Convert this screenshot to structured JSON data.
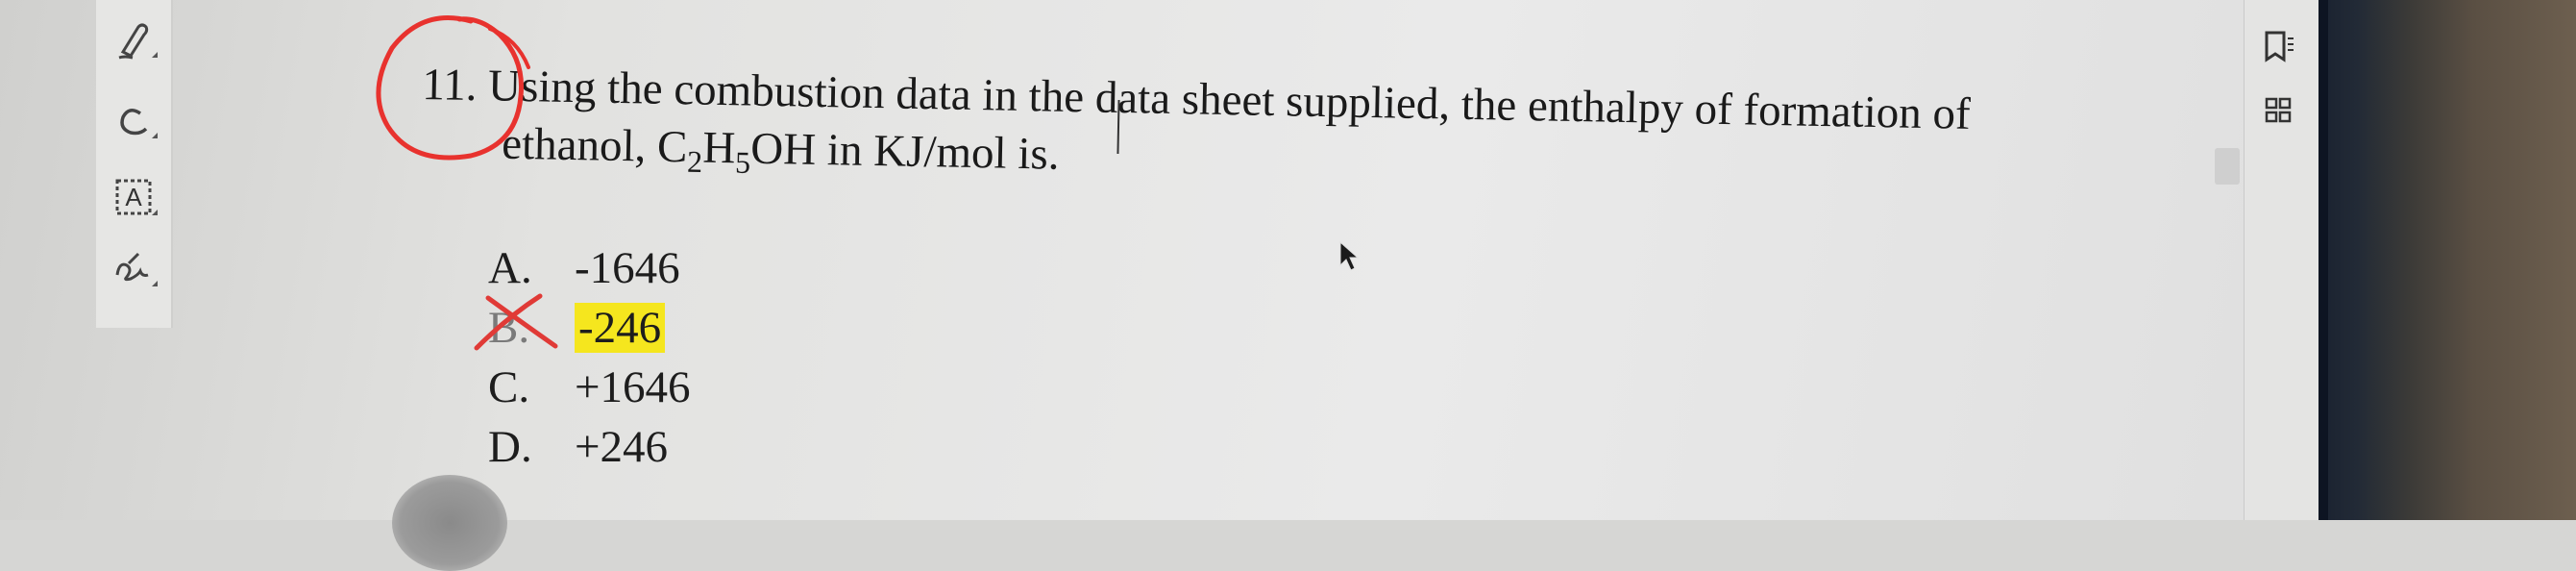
{
  "toolbar": {
    "tools": [
      {
        "name": "pen-tool",
        "icon": "pen-icon"
      },
      {
        "name": "lasso-tool",
        "icon": "lasso-icon"
      },
      {
        "name": "text-box-tool",
        "icon": "text-box-icon",
        "label": "A"
      },
      {
        "name": "signature-tool",
        "icon": "signature-icon"
      }
    ]
  },
  "question": {
    "number": "11.",
    "line1": "Using the combustion data in the data sheet supplied, the enthalpy of formation of",
    "line2_prefix": "ethanol, C",
    "sub1": "2",
    "line2_mid": "H",
    "sub2": "5",
    "line2_suffix": "OH in KJ/mol is."
  },
  "choices": [
    {
      "letter": "A.",
      "value": "-1646"
    },
    {
      "letter": "B.",
      "value": "-246"
    },
    {
      "letter": "C.",
      "value": "+1646"
    },
    {
      "letter": "D.",
      "value": "+246"
    }
  ],
  "annotations": {
    "circle_color": "#e8322e",
    "strike_color": "#e03a36",
    "highlight_color": "#f5e61e"
  },
  "right_panel": {
    "icons": [
      "reader-mode-icon",
      "thumbnail-grid-icon"
    ]
  }
}
